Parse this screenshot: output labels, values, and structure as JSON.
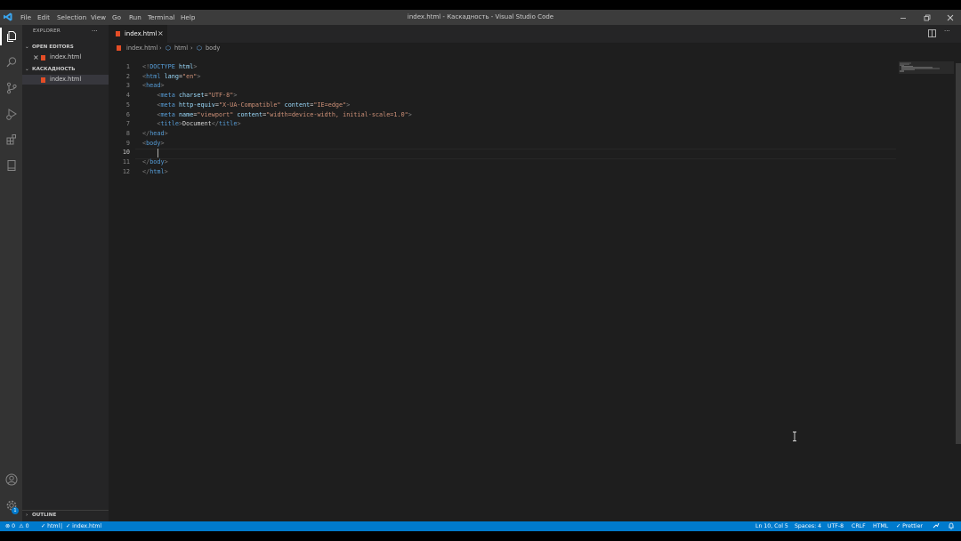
{
  "window": {
    "title": "index.html - Каскадность - Visual Studio Code",
    "menu": [
      "File",
      "Edit",
      "Selection",
      "View",
      "Go",
      "Run",
      "Terminal",
      "Help"
    ]
  },
  "sidebar": {
    "header": "EXPLORER",
    "more": "···",
    "open_editors_title": "OPEN EDITORS",
    "open_editors": [
      {
        "name": "index.html"
      }
    ],
    "folder_title": "КАСКАДНОСТЬ",
    "files": [
      {
        "name": "index.html"
      }
    ],
    "outline_title": "OUTLINE"
  },
  "editor": {
    "tab": {
      "label": "index.html",
      "close": "×"
    },
    "breadcrumb": [
      "index.html",
      "html",
      "body"
    ],
    "line_numbers": [
      "1",
      "2",
      "3",
      "4",
      "5",
      "6",
      "7",
      "8",
      "9",
      "10",
      "11",
      "12"
    ],
    "current_line": "10",
    "lines": [
      [
        {
          "c": "t",
          "v": "<!"
        },
        {
          "c": "tg",
          "v": "DOCTYPE"
        },
        {
          "c": "tx",
          "v": " "
        },
        {
          "c": "at",
          "v": "html"
        },
        {
          "c": "t",
          "v": ">"
        }
      ],
      [
        {
          "c": "t",
          "v": "<"
        },
        {
          "c": "tg",
          "v": "html"
        },
        {
          "c": "tx",
          "v": " "
        },
        {
          "c": "at",
          "v": "lang"
        },
        {
          "c": "tx",
          "v": "="
        },
        {
          "c": "sv",
          "v": "\"en\""
        },
        {
          "c": "t",
          "v": ">"
        }
      ],
      [
        {
          "c": "t",
          "v": "<"
        },
        {
          "c": "tg",
          "v": "head"
        },
        {
          "c": "t",
          "v": ">"
        }
      ],
      [
        {
          "c": "tx",
          "v": "    "
        },
        {
          "c": "t",
          "v": "<"
        },
        {
          "c": "tg",
          "v": "meta"
        },
        {
          "c": "tx",
          "v": " "
        },
        {
          "c": "at",
          "v": "charset"
        },
        {
          "c": "tx",
          "v": "="
        },
        {
          "c": "sv",
          "v": "\"UTF-8\""
        },
        {
          "c": "t",
          "v": ">"
        }
      ],
      [
        {
          "c": "tx",
          "v": "    "
        },
        {
          "c": "t",
          "v": "<"
        },
        {
          "c": "tg",
          "v": "meta"
        },
        {
          "c": "tx",
          "v": " "
        },
        {
          "c": "at",
          "v": "http-equiv"
        },
        {
          "c": "tx",
          "v": "="
        },
        {
          "c": "sv",
          "v": "\"X-UA-Compatible\""
        },
        {
          "c": "tx",
          "v": " "
        },
        {
          "c": "at",
          "v": "content"
        },
        {
          "c": "tx",
          "v": "="
        },
        {
          "c": "sv",
          "v": "\"IE=edge\""
        },
        {
          "c": "t",
          "v": ">"
        }
      ],
      [
        {
          "c": "tx",
          "v": "    "
        },
        {
          "c": "t",
          "v": "<"
        },
        {
          "c": "tg",
          "v": "meta"
        },
        {
          "c": "tx",
          "v": " "
        },
        {
          "c": "at",
          "v": "name"
        },
        {
          "c": "tx",
          "v": "="
        },
        {
          "c": "sv",
          "v": "\"viewport\""
        },
        {
          "c": "tx",
          "v": " "
        },
        {
          "c": "at",
          "v": "content"
        },
        {
          "c": "tx",
          "v": "="
        },
        {
          "c": "sv",
          "v": "\"width=device-width, initial-scale=1.0\""
        },
        {
          "c": "t",
          "v": ">"
        }
      ],
      [
        {
          "c": "tx",
          "v": "    "
        },
        {
          "c": "t",
          "v": "<"
        },
        {
          "c": "tg",
          "v": "title"
        },
        {
          "c": "t",
          "v": ">"
        },
        {
          "c": "tx",
          "v": "Document"
        },
        {
          "c": "t",
          "v": "</"
        },
        {
          "c": "tg",
          "v": "title"
        },
        {
          "c": "t",
          "v": ">"
        }
      ],
      [
        {
          "c": "t",
          "v": "</"
        },
        {
          "c": "tg",
          "v": "head"
        },
        {
          "c": "t",
          "v": ">"
        }
      ],
      [
        {
          "c": "t",
          "v": "<"
        },
        {
          "c": "tg",
          "v": "body"
        },
        {
          "c": "t",
          "v": ">"
        }
      ],
      [
        {
          "c": "tx",
          "v": "    "
        }
      ],
      [
        {
          "c": "t",
          "v": "</"
        },
        {
          "c": "tg",
          "v": "body"
        },
        {
          "c": "t",
          "v": ">"
        }
      ],
      [
        {
          "c": "t",
          "v": "</"
        },
        {
          "c": "tg",
          "v": "html"
        },
        {
          "c": "t",
          "v": ">"
        }
      ]
    ]
  },
  "status": {
    "errors": "0",
    "warnings": "0",
    "html_check": "html",
    "file_check": "index.html",
    "position": "Ln 10, Col 5",
    "spaces": "Spaces: 4",
    "encoding": "UTF-8",
    "eol": "CRLF",
    "language": "HTML",
    "prettier": "Prettier",
    "accounts_badge": "1"
  },
  "colors": {
    "accent": "#007acc",
    "html_icon": "#e44d26",
    "keyword": "#569cd6",
    "attr": "#9cdcfe",
    "string": "#ce9178"
  }
}
